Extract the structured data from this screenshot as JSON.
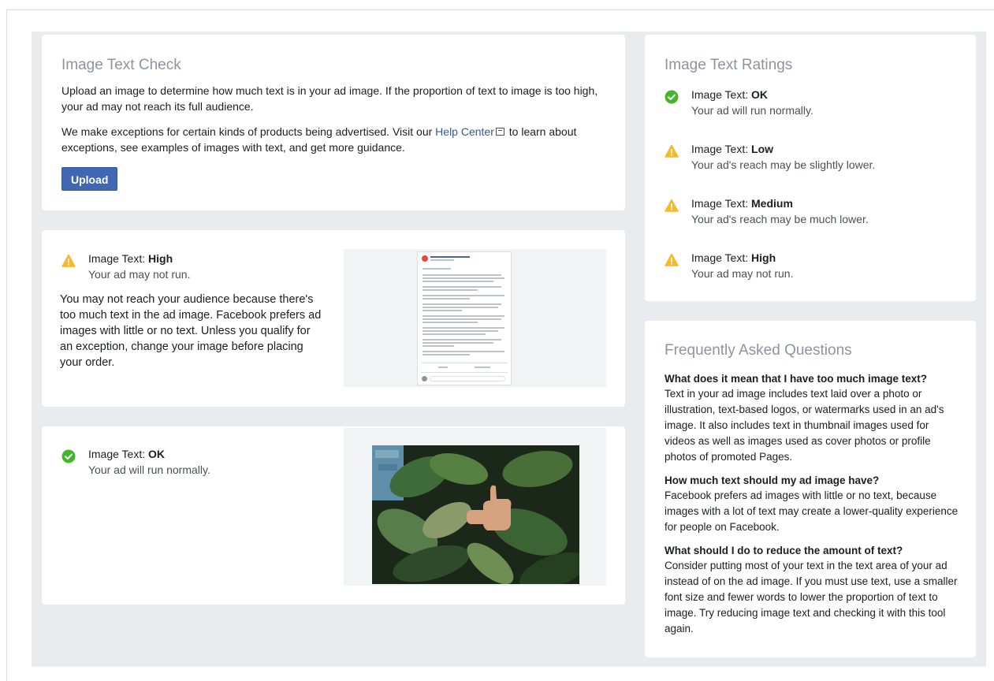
{
  "image_text_check": {
    "title": "Image Text Check",
    "intro": "Upload an image to determine how much text is in your ad image. If the proportion of text to image is too high, your ad may not reach its full audience.",
    "exceptions_before": "We make exceptions for certain kinds of products being advertised. Visit our ",
    "help_center_link": "Help Center",
    "exceptions_after": " to learn about exceptions, see examples of images with text, and get more guidance.",
    "upload_label": "Upload"
  },
  "result_high": {
    "label_prefix": "Image Text: ",
    "level": "High",
    "desc": "Your ad may not run.",
    "explanation": "You may not reach your audience because there's too much text in the ad image. Facebook prefers ad images with little or no text. Unless you qualify for an exception, change your image before placing your order."
  },
  "result_ok": {
    "label_prefix": "Image Text: ",
    "level": "OK",
    "desc": "Your ad will run normally."
  },
  "ratings": {
    "title": "Image Text Ratings",
    "items": [
      {
        "prefix": "Image Text: ",
        "level": "OK",
        "desc": "Your ad will run normally.",
        "icon": "check-circle-icon"
      },
      {
        "prefix": "Image Text: ",
        "level": "Low",
        "desc": "Your ad's reach may be slightly lower.",
        "icon": "warning-icon"
      },
      {
        "prefix": "Image Text: ",
        "level": "Medium",
        "desc": "Your ad's reach may be much lower.",
        "icon": "warning-icon"
      },
      {
        "prefix": "Image Text: ",
        "level": "High",
        "desc": "Your ad may not run.",
        "icon": "warning-icon"
      }
    ]
  },
  "faq": {
    "title": "Frequently Asked Questions",
    "items": [
      {
        "q": "What does it mean that I have too much image text?",
        "a": "Text in your ad image includes text laid over a photo or illustration, text-based logos, or watermarks used in an ad's image. It also includes text in thumbnail images used for videos as well as images used as cover photos or profile photos of promoted Pages."
      },
      {
        "q": "How much text should my ad image have?",
        "a": "Facebook prefers ad images with little or no text, because images with a lot of text may create a lower-quality experience for people on Facebook."
      },
      {
        "q": "What should I do to reduce the amount of text?",
        "a": "Consider putting most of your text in the text area of your ad instead of on the ad image. If you must use text, use a smaller font size and fewer words to lower the proportion of text to image. Try reducing image text and checking it with this tool again."
      }
    ]
  },
  "colors": {
    "ok": "#42b72a",
    "warning": "#f7b928",
    "button": "#4267b2",
    "link": "#365899",
    "title_gray": "#8d949e"
  }
}
